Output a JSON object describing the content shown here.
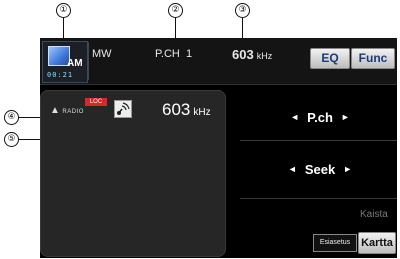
{
  "callouts": [
    "①",
    "②",
    "③",
    "④",
    "⑤"
  ],
  "band_indicator": {
    "label": "AM",
    "time": "00:21"
  },
  "status": {
    "band": "MW",
    "preset": "P.CH  1",
    "frequency": "603",
    "frequency_unit": "kHz"
  },
  "buttons": {
    "eq": "EQ",
    "func": "Func"
  },
  "panel": {
    "logo_text": "RADIO",
    "loc": "LOC",
    "frequency": "603",
    "frequency_unit": "kHz"
  },
  "controls": {
    "pch_label": "P.ch",
    "seek_label": "Seek",
    "left_arrow": "◄",
    "right_arrow": "►",
    "band_button": "Kaista",
    "preset_button": "Esiasetus",
    "map_button": "Kartta"
  }
}
